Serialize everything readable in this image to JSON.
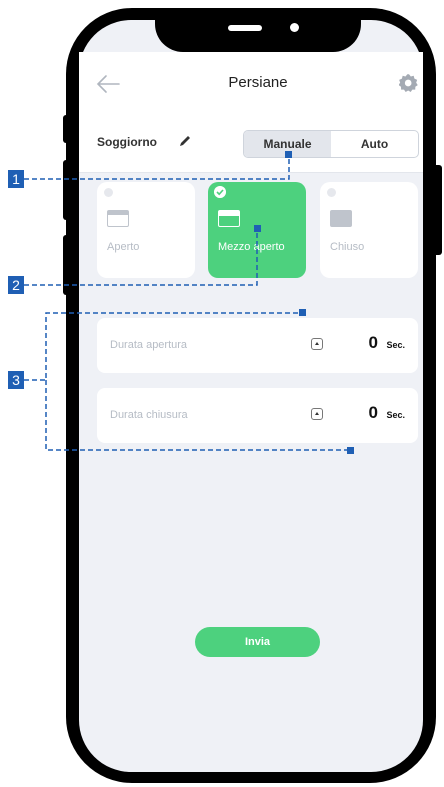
{
  "header": {
    "title": "Persiane"
  },
  "room": {
    "name": "Soggiorno"
  },
  "mode_toggle": {
    "manual_label": "Manuale",
    "auto_label": "Auto",
    "selected": "Manuale"
  },
  "position_cards": [
    {
      "label": "Aperto",
      "selected": false
    },
    {
      "label": "Mezzo aperto",
      "selected": true
    },
    {
      "label": "Chiuso",
      "selected": false
    }
  ],
  "durations": [
    {
      "label": "Durata apertura",
      "value": "0",
      "unit": "Sec."
    },
    {
      "label": "Durata chiusura",
      "value": "0",
      "unit": "Sec."
    }
  ],
  "submit_label": "Invia",
  "callouts": [
    {
      "number": "1"
    },
    {
      "number": "2"
    },
    {
      "number": "3"
    }
  ],
  "colors": {
    "accent": "#4dd17e",
    "callout": "#1f5fb4",
    "screen_bg": "#eff1f6"
  }
}
